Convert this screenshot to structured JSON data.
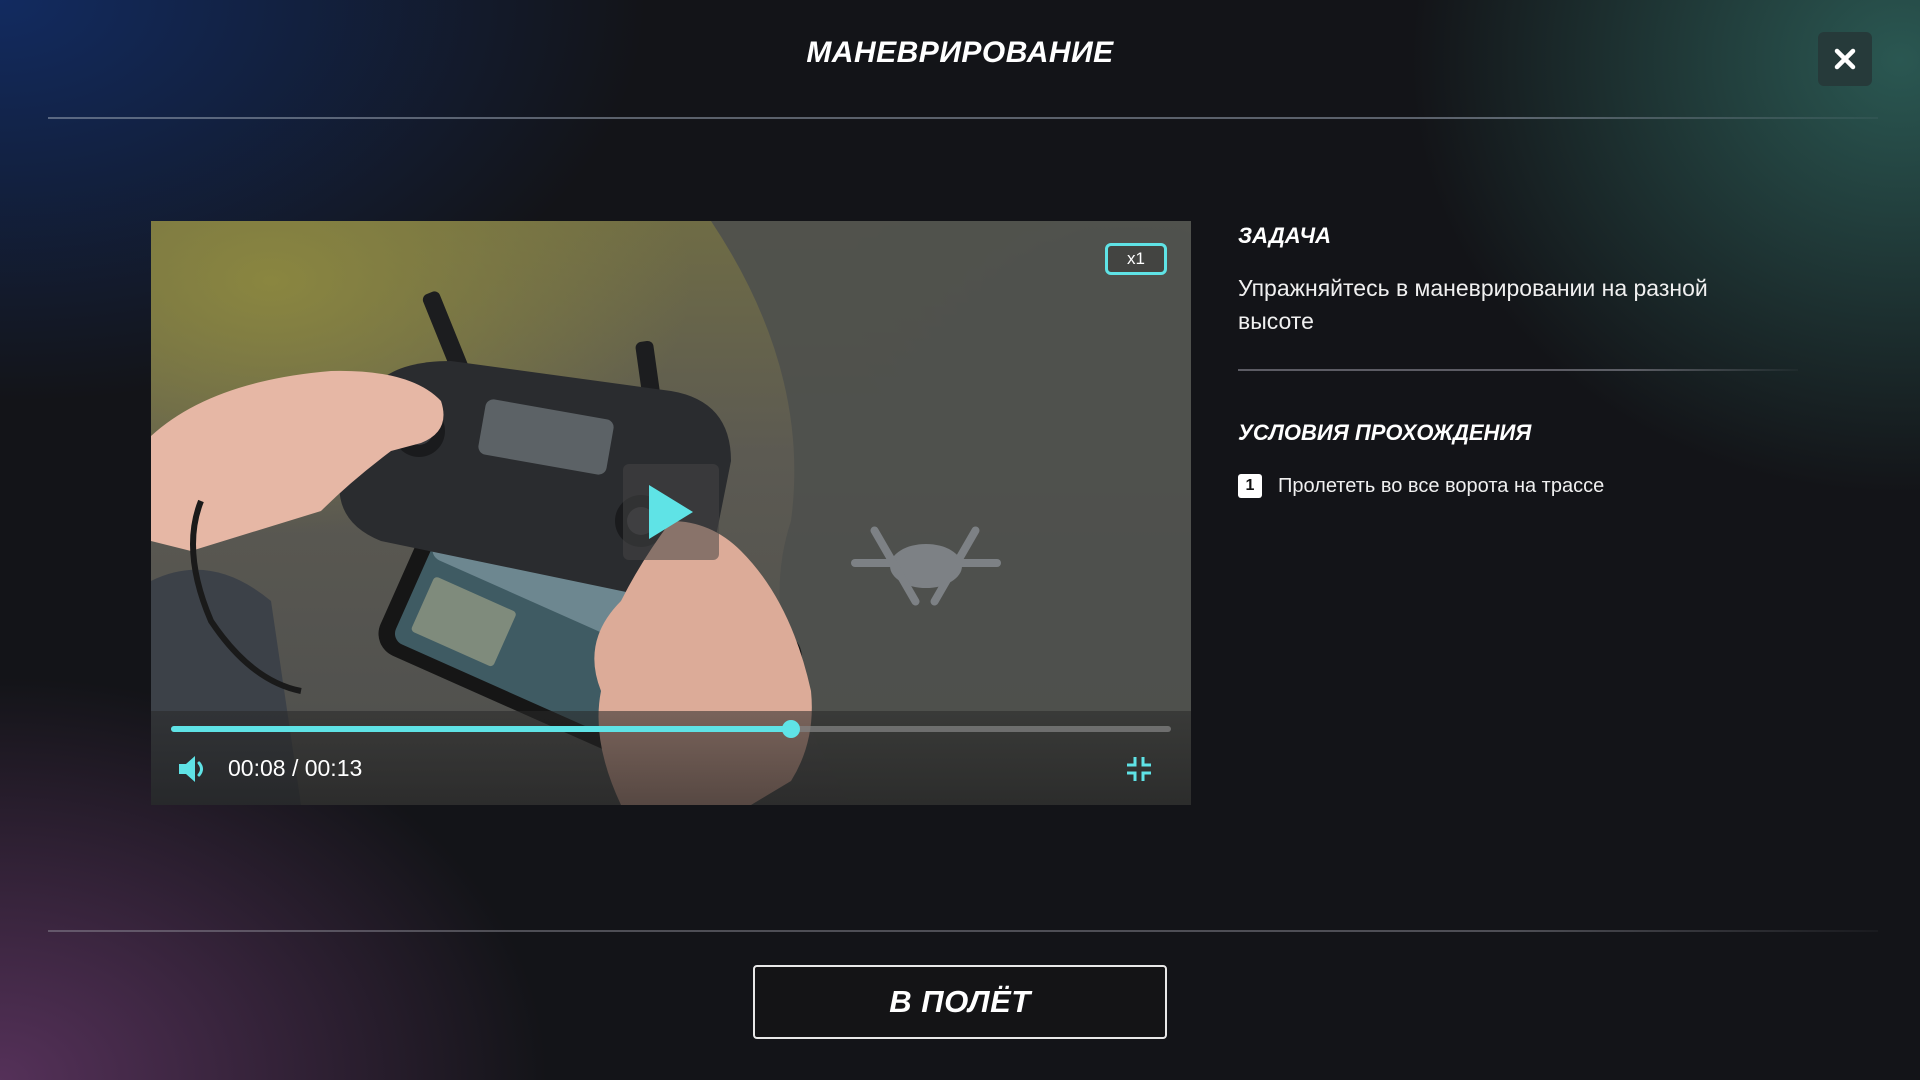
{
  "header": {
    "title": "МАНЕВРИРОВАНИЕ",
    "close_icon": "close-icon"
  },
  "video": {
    "speed_label": "x1",
    "time_label": "00:08 / 00:13",
    "progress_fraction": 0.62,
    "play_icon": "play-icon",
    "volume_icon": "volume-icon",
    "fullscreen_icon": "exit-fullscreen-icon",
    "accent_color": "#5fe3e6"
  },
  "panel": {
    "task_title": "ЗАДАЧА",
    "task_text": "Упражняйтесь в маневрировании на разной высоте",
    "conditions_title": "УСЛОВИЯ ПРОХОЖДЕНИЯ",
    "conditions": [
      {
        "number": "1",
        "text": "Пролететь во все ворота на трассе"
      }
    ]
  },
  "footer": {
    "fly_button_label": "В ПОЛЁТ"
  }
}
